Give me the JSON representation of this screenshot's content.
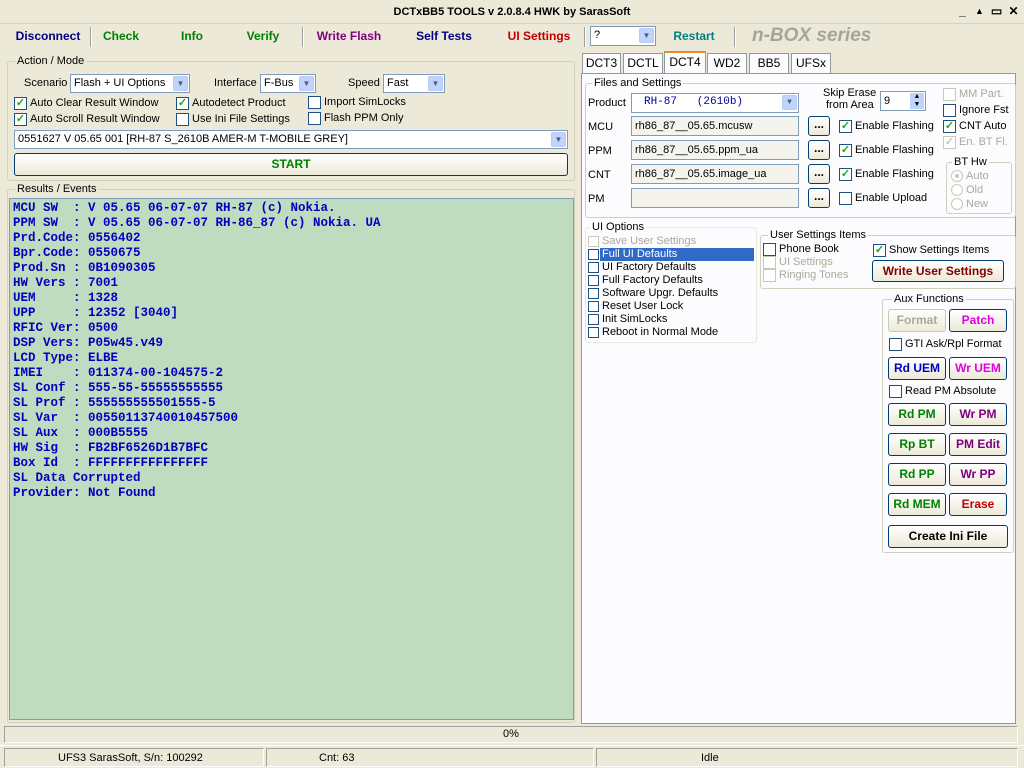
{
  "window": {
    "title": "DCTxBB5 TOOLS v 2.0.8.4 HWK by SarasSoft",
    "controls": [
      "_",
      "▲",
      "▭",
      "✕"
    ]
  },
  "toolbar": {
    "buttons": [
      {
        "label": "Disconnect",
        "color": "#000080"
      },
      {
        "label": "Check",
        "color": "#008000"
      },
      {
        "label": "Info",
        "color": "#008000"
      },
      {
        "label": "Verify",
        "color": "#008000"
      },
      {
        "label": "Write Flash",
        "color": "#800080"
      },
      {
        "label": "Self Tests",
        "color": "#000080"
      },
      {
        "label": "UI Settings",
        "color": "#c00000"
      },
      {
        "label": "Restart",
        "color": "#008080"
      }
    ],
    "combo_value": "?",
    "brand": "n-BOX series"
  },
  "action_mode": {
    "title": "Action / Mode",
    "scenario_label": "Scenario",
    "scenario_value": "Flash + UI Options",
    "interface_label": "Interface",
    "interface_value": "F-Bus",
    "speed_label": "Speed",
    "speed_value": "Fast",
    "checks": [
      {
        "label": "Auto Clear Result Window",
        "checked": true
      },
      {
        "label": "Autodetect Product",
        "checked": true
      },
      {
        "label": "Import SimLocks",
        "checked": false
      },
      {
        "label": "Auto Scroll Result Window",
        "checked": true
      },
      {
        "label": "Use Ini File Settings",
        "checked": false
      },
      {
        "label": "Flash PPM Only",
        "checked": false
      }
    ],
    "product_line": "0551627 V 05.65 001  [RH-87 S_2610B AMER-M T-MOBILE GREY]",
    "start_label": "START"
  },
  "results": {
    "title": "Results / Events",
    "lines": [
      "MCU SW  : V 05.65 06-07-07 RH-87 (c) Nokia.",
      "PPM SW  : V 05.65 06-07-07 RH-86_87 (c) Nokia. UA",
      "Prd.Code: 0556402",
      "Bpr.Code: 0550675",
      "Prod.Sn : 0B1090305",
      "HW Vers : 7001",
      "UEM     : 1328",
      "UPP     : 12352 [3040]",
      "RFIC Ver: 0500",
      "DSP Vers: P05w45.v49",
      "LCD Type: ELBE",
      "IMEI    : 011374-00-104575-2",
      "SL Conf : 555-55-55555555555",
      "SL Prof : 555555555501555-5",
      "SL Var  : 00550113740010457500",
      "SL Aux  : 000B5555",
      "HW Sig  : FB2BF6526D1B7BFC",
      "Box Id  : FFFFFFFFFFFFFFFF",
      "SL Data Corrupted",
      "Provider: Not Found"
    ]
  },
  "tabs": [
    "DCT3",
    "DCTL",
    "DCT4",
    "WD2",
    "BB5",
    "UFSx"
  ],
  "active_tab": "DCT4",
  "files": {
    "title": "Files and Settings",
    "product_label": "Product",
    "product_value": "RH-87   (2610b)",
    "rows": [
      {
        "label": "MCU",
        "value": "rh86_87__05.65.mcusw",
        "check_label": "Enable Flashing",
        "checked": true
      },
      {
        "label": "PPM",
        "value": "rh86_87__05.65.ppm_ua",
        "check_label": "Enable Flashing",
        "checked": true
      },
      {
        "label": "CNT",
        "value": "rh86_87__05.65.image_ua",
        "check_label": "Enable Flashing",
        "checked": true
      },
      {
        "label": "PM",
        "value": "",
        "check_label": "Enable Upload",
        "checked": false
      }
    ],
    "dots_label": "...",
    "skip_erase_label": "Skip Erase",
    "skip_erase_label2": "from Area",
    "skip_erase_value": "9",
    "right_checks": [
      {
        "label": "MM Part.",
        "checked": false,
        "disabled": true
      },
      {
        "label": "Ignore Fst",
        "checked": false,
        "disabled": false
      },
      {
        "label": "CNT Auto",
        "checked": true,
        "disabled": false
      },
      {
        "label": "En. BT Fl.",
        "checked": true,
        "disabled": true
      }
    ],
    "bt_hw": {
      "title": "BT Hw",
      "options": [
        "Auto",
        "Old",
        "New"
      ],
      "selected": "Auto"
    }
  },
  "ui_options": {
    "title": "UI Options",
    "items": [
      {
        "label": "Save User Settings",
        "disabled": true,
        "selected": false
      },
      {
        "label": "Full UI Defaults",
        "disabled": false,
        "selected": true
      },
      {
        "label": "UI Factory Defaults",
        "disabled": false,
        "selected": false
      },
      {
        "label": "Full Factory Defaults",
        "disabled": false,
        "selected": false
      },
      {
        "label": "Software Upgr. Defaults",
        "disabled": false,
        "selected": false
      },
      {
        "label": "Reset User Lock",
        "disabled": false,
        "selected": false
      },
      {
        "label": "Init SimLocks",
        "disabled": false,
        "selected": false
      },
      {
        "label": "Reboot in Normal Mode",
        "disabled": false,
        "selected": false
      }
    ]
  },
  "user_settings": {
    "title": "User Settings Items",
    "items": [
      {
        "label": "Phone Book",
        "disabled": false
      },
      {
        "label": "UI Settings",
        "disabled": true
      },
      {
        "label": "Ringing Tones",
        "disabled": true
      }
    ],
    "show_label": "Show Settings Items",
    "show_checked": true,
    "write_label": "Write User Settings"
  },
  "aux": {
    "title": "Aux Functions",
    "format": "Format",
    "patch": "Patch",
    "gti_label": "GTI Ask/Rpl Format",
    "rd_uem": "Rd UEM",
    "wr_uem": "Wr UEM",
    "read_pm_abs": "Read PM Absolute",
    "rd_pm": "Rd PM",
    "wr_pm": "Wr PM",
    "rp_bt": "Rp BT",
    "pm_edit": "PM Edit",
    "rd_pp": "Rd PP",
    "wr_pp": "Wr PP",
    "rd_mem": "Rd MEM",
    "erase": "Erase",
    "create_ini": "Create Ini File"
  },
  "progress": {
    "text": "0%",
    "value": 0
  },
  "status": {
    "serial": "UFS3 SarasSoft, S/n: 100292",
    "count": "Cnt: 63",
    "state": "Idle"
  }
}
